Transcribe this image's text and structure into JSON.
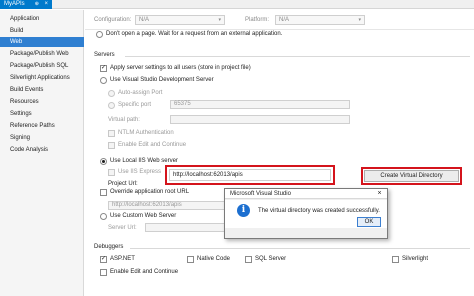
{
  "tab": {
    "title": "MyAPIs",
    "pin": "⊕",
    "close": "×"
  },
  "nav": {
    "items": [
      {
        "label": "Application"
      },
      {
        "label": "Build"
      },
      {
        "label": "Web"
      },
      {
        "label": "Package/Publish Web"
      },
      {
        "label": "Package/Publish SQL"
      },
      {
        "label": "Silverlight Applications"
      },
      {
        "label": "Build Events"
      },
      {
        "label": "Resources"
      },
      {
        "label": "Settings"
      },
      {
        "label": "Reference Paths"
      },
      {
        "label": "Signing"
      },
      {
        "label": "Code Analysis"
      }
    ],
    "active_index": 2
  },
  "config": {
    "configuration_label": "Configuration:",
    "configuration_value": "N/A",
    "platform_label": "Platform:",
    "platform_value": "N/A",
    "arrow": "▾"
  },
  "web": {
    "dont_open_label": "Don't open a page. Wait for a request from an external application.",
    "servers_header": "Servers",
    "apply_all_users_label": "Apply server settings to all users (store in project file)",
    "use_vs_dev_server_label": "Use Visual Studio Development Server",
    "auto_assign_port_label": "Auto-assign Port",
    "specific_port_label": "Specific port",
    "specific_port_value": "65375",
    "virtual_path_label": "Virtual path:",
    "ntlm_label": "NTLM Authentication",
    "edit_continue_top_label": "Enable Edit and Continue",
    "use_local_iis_label": "Use Local IIS Web server",
    "use_iis_express_label": "Use IIS Express",
    "project_url_label": "Project Url:",
    "project_url_value": "http://localhost:62013/apis",
    "create_vdir_button": "Create Virtual Directory",
    "override_root_label": "Override application root URL",
    "override_root_value": "http://localhost:62013/apis",
    "use_custom_server_label": "Use Custom Web Server",
    "server_url_label": "Server Url:",
    "debuggers_header": "Debuggers",
    "aspnet_label": "ASP.NET",
    "native_code_label": "Native Code",
    "sql_server_label": "SQL Server",
    "silverlight_label": "Silverlight",
    "edit_continue_bottom_label": "Enable Edit and Continue"
  },
  "dialog": {
    "title": "Microsoft Visual Studio",
    "close": "×",
    "icon": "i",
    "message": "The virtual directory was created successfully.",
    "ok_button": "OK"
  },
  "colors": {
    "accent": "#007acc",
    "nav_active": "#2f7fd1",
    "highlight_red": "#d4141c",
    "info_blue": "#1c6fd0"
  }
}
